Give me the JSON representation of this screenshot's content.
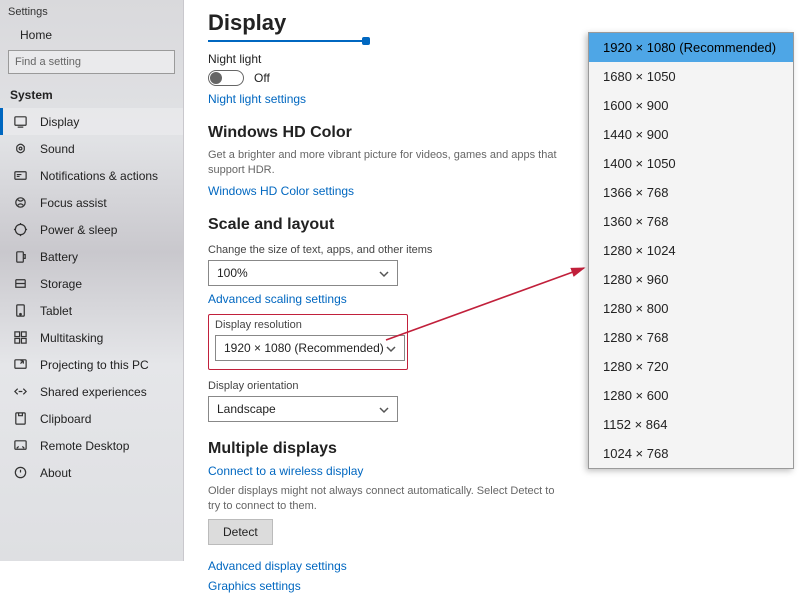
{
  "app": {
    "title": "Settings"
  },
  "sidebar": {
    "home": "Home",
    "search_placeholder": "Find a setting",
    "group": "System",
    "items": [
      {
        "label": "Display",
        "selected": true
      },
      {
        "label": "Sound"
      },
      {
        "label": "Notifications & actions"
      },
      {
        "label": "Focus assist"
      },
      {
        "label": "Power & sleep"
      },
      {
        "label": "Battery"
      },
      {
        "label": "Storage"
      },
      {
        "label": "Tablet"
      },
      {
        "label": "Multitasking"
      },
      {
        "label": "Projecting to this PC"
      },
      {
        "label": "Shared experiences"
      },
      {
        "label": "Clipboard"
      },
      {
        "label": "Remote Desktop"
      },
      {
        "label": "About"
      }
    ]
  },
  "main": {
    "heading": "Display",
    "night_light": {
      "label": "Night light",
      "state": "Off",
      "link": "Night light settings"
    },
    "hd": {
      "heading": "Windows HD Color",
      "desc": "Get a brighter and more vibrant picture for videos, games and apps that support HDR.",
      "link": "Windows HD Color settings"
    },
    "scale": {
      "heading": "Scale and layout",
      "size_label": "Change the size of text, apps, and other items",
      "size_value": "100%",
      "adv_link": "Advanced scaling settings",
      "res_label": "Display resolution",
      "res_value": "1920 × 1080 (Recommended)",
      "orient_label": "Display orientation",
      "orient_value": "Landscape"
    },
    "multi": {
      "heading": "Multiple displays",
      "connect_link": "Connect to a wireless display",
      "desc": "Older displays might not always connect automatically. Select Detect to try to connect to them.",
      "detect_btn": "Detect",
      "adv_link": "Advanced display settings",
      "gfx_link": "Graphics settings"
    }
  },
  "resolution_options": [
    {
      "value": "1920 × 1080 (Recommended)",
      "selected": true
    },
    {
      "value": "1680 × 1050"
    },
    {
      "value": "1600 × 900"
    },
    {
      "value": "1440 × 900"
    },
    {
      "value": "1400 × 1050"
    },
    {
      "value": "1366 × 768"
    },
    {
      "value": "1360 × 768"
    },
    {
      "value": "1280 × 1024"
    },
    {
      "value": "1280 × 960"
    },
    {
      "value": "1280 × 800"
    },
    {
      "value": "1280 × 768"
    },
    {
      "value": "1280 × 720"
    },
    {
      "value": "1280 × 600"
    },
    {
      "value": "1152 × 864"
    },
    {
      "value": "1024 × 768"
    }
  ]
}
